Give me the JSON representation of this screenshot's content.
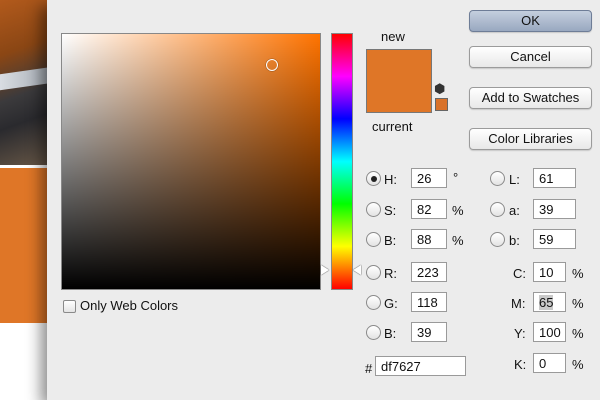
{
  "dialog": {
    "buttons": {
      "ok": "OK",
      "cancel": "Cancel",
      "add_to_swatches": "Add to Swatches",
      "color_libraries": "Color Libraries"
    },
    "swatch": {
      "new_label": "new",
      "current_label": "current",
      "color": "#df7627"
    },
    "only_web_colors": {
      "label": "Only Web Colors",
      "checked": false
    },
    "hsb": {
      "h": {
        "label": "H:",
        "value": "26",
        "unit": "°"
      },
      "s": {
        "label": "S:",
        "value": "82",
        "unit": "%"
      },
      "b": {
        "label": "B:",
        "value": "88",
        "unit": "%"
      },
      "selected": "H"
    },
    "rgb": {
      "r": {
        "label": "R:",
        "value": "223"
      },
      "g": {
        "label": "G:",
        "value": "118"
      },
      "b": {
        "label": "B:",
        "value": "39"
      }
    },
    "lab": {
      "l": {
        "label": "L:",
        "value": "61"
      },
      "a": {
        "label": "a:",
        "value": "39"
      },
      "b": {
        "label": "b:",
        "value": "59"
      }
    },
    "cmyk": {
      "c": {
        "label": "C:",
        "value": "10",
        "unit": "%"
      },
      "m": {
        "label": "M:",
        "value": "65",
        "unit": "%"
      },
      "y": {
        "label": "Y:",
        "value": "100",
        "unit": "%"
      },
      "k": {
        "label": "K:",
        "value": "0",
        "unit": "%"
      }
    },
    "hex": {
      "label": "#",
      "value": "df7627"
    },
    "icons": [
      "out-of-gamut-cube-icon",
      "hue-slider-left-arrow",
      "hue-slider-right-arrow",
      "field-picker-circle"
    ]
  },
  "background": {
    "swatch_color": "#df7627"
  }
}
